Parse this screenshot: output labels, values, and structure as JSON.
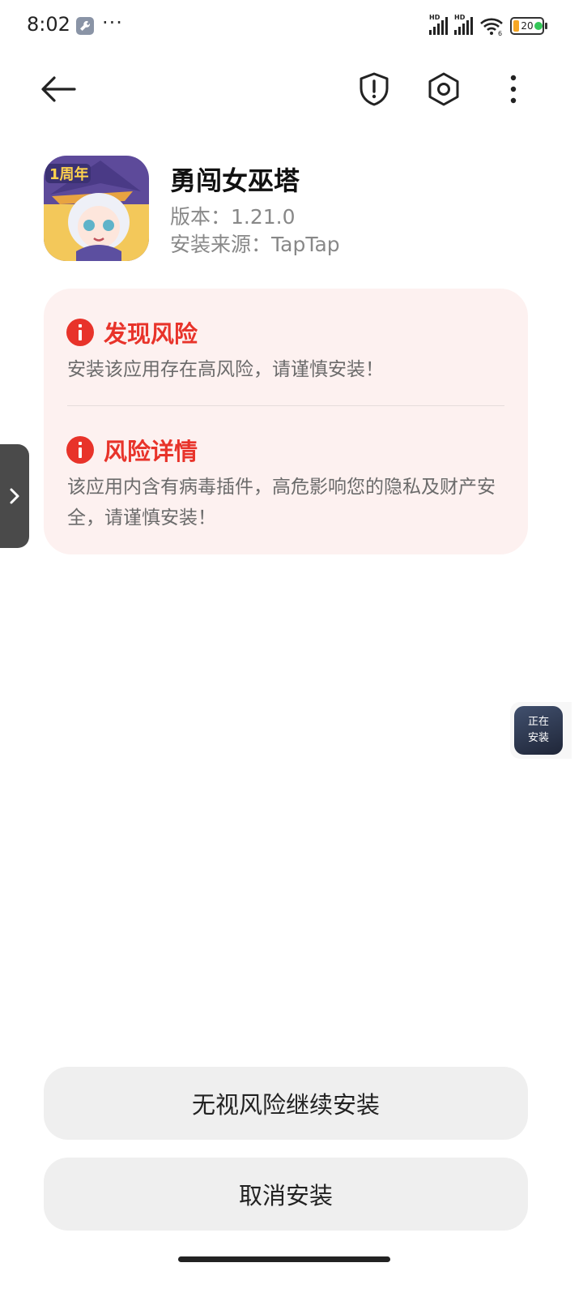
{
  "status_bar": {
    "time": "8:02",
    "more": "···",
    "network_badges": [
      "HD",
      "HD"
    ],
    "wifi_badge": "6",
    "battery": "20",
    "battery_color": "#f5a623",
    "dot_color": "#34c759"
  },
  "app_bar": {
    "icons": [
      "back-arrow-icon",
      "shield-alert-icon",
      "settings-hexagon-icon",
      "more-vertical-icon"
    ]
  },
  "app": {
    "name": "勇闯女巫塔",
    "version": "版本：1.21.0",
    "source": "安装来源：TapTap",
    "icon_badge": "1周年"
  },
  "risk_card": {
    "background": "#fdf1f0",
    "accent_color": "#e8332a",
    "sections": [
      {
        "title": "发现风险",
        "text": "安装该应用存在高风险，请谨慎安装！"
      },
      {
        "title": "风险详情",
        "text": "该应用内含有病毒插件，高危影响您的隐私及财产安全，请谨慎安装！"
      }
    ]
  },
  "floating_widget": {
    "line1": "正在",
    "line2": "安装"
  },
  "buttons": {
    "continue": "无视风险继续安装",
    "cancel": "取消安装"
  }
}
